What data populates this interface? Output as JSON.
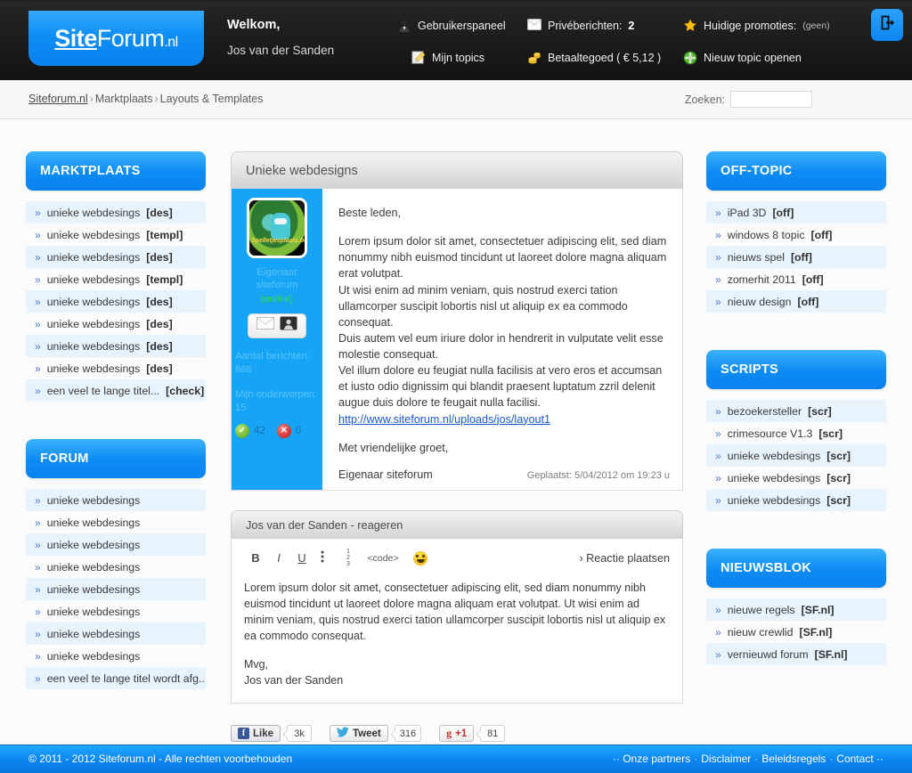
{
  "header": {
    "logo": {
      "bold": "Site",
      "rest": "Forum",
      "tld": ".nl"
    },
    "welcome_label": "Welkom,",
    "user_name": "Jos van der Sanden",
    "menu": [
      {
        "icon": "user-panel-icon",
        "label": "Gebruikerspaneel",
        "value": "",
        "dim": ""
      },
      {
        "icon": "envelope-icon",
        "label": "Privéberichten:",
        "value": "2",
        "dim": ""
      },
      {
        "icon": "star-icon",
        "label": "Huidige promoties:",
        "value": "",
        "dim": "(geen)"
      },
      {
        "icon": "pencil-note-icon",
        "label": "Mijn topics",
        "value": "",
        "dim": ""
      },
      {
        "icon": "coins-icon",
        "label": "Betaaltegoed ( € 5,12 )",
        "value": "",
        "dim": ""
      },
      {
        "icon": "plus-circle-icon",
        "label": "Nieuw topic openen",
        "value": "",
        "dim": ""
      }
    ],
    "logout_icon": "logout-icon"
  },
  "breadcrumb": {
    "root": "Siteforum.nl",
    "sep1": "›",
    "level1": "Marktplaats",
    "sep2": "›",
    "level2": "Layouts & Templates"
  },
  "search": {
    "label": "Zoeken:",
    "value": "",
    "placeholder": ""
  },
  "sidebar_left": [
    {
      "title": "MARKTPLAATS",
      "items": [
        {
          "label": "unieke webdesings",
          "tag": "[des]"
        },
        {
          "label": "unieke webdesings",
          "tag": "[templ]"
        },
        {
          "label": "unieke webdesings",
          "tag": "[des]"
        },
        {
          "label": "unieke webdesings",
          "tag": "[templ]"
        },
        {
          "label": "unieke webdesings",
          "tag": "[des]"
        },
        {
          "label": "unieke webdesings",
          "tag": "[des]"
        },
        {
          "label": "unieke webdesings",
          "tag": "[des]"
        },
        {
          "label": "unieke webdesings",
          "tag": "[des]"
        },
        {
          "label": "een veel te lange titel...",
          "tag": "[check]"
        }
      ]
    },
    {
      "title": "FORUM",
      "items": [
        {
          "label": "unieke webdesings",
          "tag": ""
        },
        {
          "label": "unieke webdesings",
          "tag": ""
        },
        {
          "label": "unieke webdesings",
          "tag": ""
        },
        {
          "label": "unieke webdesings",
          "tag": ""
        },
        {
          "label": "unieke webdesings",
          "tag": ""
        },
        {
          "label": "unieke webdesings",
          "tag": ""
        },
        {
          "label": "unieke webdesings",
          "tag": ""
        },
        {
          "label": "unieke webdesings",
          "tag": ""
        },
        {
          "label": "een veel te lange titel wordt afg...",
          "tag": ""
        }
      ]
    }
  ],
  "sidebar_right": [
    {
      "title": "OFF-TOPIC",
      "items": [
        {
          "label": "iPad 3D",
          "tag": "[off]"
        },
        {
          "label": "windows 8 topic",
          "tag": "[off]"
        },
        {
          "label": "nieuws spel",
          "tag": "[off]"
        },
        {
          "label": "zomerhit 2011",
          "tag": "[off]"
        },
        {
          "label": "nieuw design",
          "tag": "[off]"
        }
      ]
    },
    {
      "title": "SCRIPTS",
      "items": [
        {
          "label": "bezoekersteller",
          "tag": "[scr]"
        },
        {
          "label": "crimesource V1.3",
          "tag": "[scr]"
        },
        {
          "label": "unieke webdesings",
          "tag": "[scr]"
        },
        {
          "label": "unieke webdesings",
          "tag": "[scr]"
        },
        {
          "label": "unieke webdesings",
          "tag": "[scr]"
        }
      ]
    },
    {
      "title": "NIEUWSBLOK",
      "items": [
        {
          "label": "nieuwe regels",
          "tag": "[SF.nl]"
        },
        {
          "label": "nieuw crewlid",
          "tag": "[SF.nl]"
        },
        {
          "label": "vernieuwd forum",
          "tag": "[SF.nl]"
        }
      ]
    }
  ],
  "post": {
    "title": "Unieke webdesigns",
    "author": {
      "avatar_caption": "Spelletjesplaats.be",
      "name": "Eigenaar siteforum",
      "status": "(online)",
      "pm_icon": "envelope-icon",
      "profile_icon": "profile-card-icon",
      "posts_label": "Aantal berichten:",
      "posts_value": "866",
      "topics_label": "Mijn onderwerpen:",
      "topics_value": "15",
      "positive": "42",
      "negative": "0"
    },
    "greeting": "Beste leden,",
    "paragraphs": [
      "Lorem ipsum dolor sit amet, consectetuer adipiscing elit, sed diam nonummy nibh euismod tincidunt ut laoreet dolore magna aliquam erat volutpat.",
      "Ut wisi enim ad minim veniam, quis nostrud exerci tation ullamcorper suscipit lobortis nisl ut aliquip ex ea commodo consequat.",
      "Duis autem vel eum iriure dolor in hendrerit in vulputate velit esse molestie consequat.",
      "Vel illum dolore eu feugiat nulla facilisis at vero eros et accumsan et iusto odio dignissim qui blandit praesent luptatum zzril delenit augue duis dolore te feugait nulla facilisi."
    ],
    "link": "http://www.siteforum.nl/uploads/jos/layout1",
    "closing": "Met vriendelijke groet,",
    "signature": "Eigenaar siteforum",
    "timestamp": "Geplaatst: 5/04/2012 om 19:23 u"
  },
  "reply": {
    "header": "Jos van der Sanden - reageren",
    "toolbar": {
      "bold": "B",
      "italic": "I",
      "underline": "U",
      "bullet_list": "bullet-list-icon",
      "numbered_list_1": "1",
      "numbered_list_2": "2",
      "numbered_list_3": "3",
      "code": "<code>",
      "smiley": "smiley-icon"
    },
    "submit_label": "› Reactie plaatsen",
    "body_line1": "Lorem ipsum dolor sit amet, consectetuer adipiscing elit, sed diam nonummy nibh euismod tincidunt ut laoreet dolore magna aliquam erat volutpat. Ut wisi enim ad minim veniam, quis nostrud exerci tation ullamcorper suscipit lobortis nisl ut aliquip ex ea commodo consequat.",
    "body_line2": "Mvg,",
    "body_line3": "Jos van der Sanden"
  },
  "social": {
    "facebook": {
      "label": "Like",
      "count": "3k",
      "icon": "facebook-icon"
    },
    "twitter": {
      "label": "Tweet",
      "count": "316",
      "icon": "twitter-bird-icon"
    },
    "google": {
      "label": "+1",
      "count": "81",
      "icon": "google-plus-icon"
    }
  },
  "footer": {
    "copyright": "© 2011 - 2012  Siteforum.nl  - Alle rechten voorbehouden",
    "prefix": "··",
    "links": [
      "Onze partners",
      "Disclaimer",
      "Beleidsregels",
      "Contact"
    ],
    "suffix": "··"
  },
  "colors": {
    "brand_blue": "#0d8cf4",
    "header_dark": "#1b1b1b",
    "row_alt": "#e8f4fd",
    "online_green": "#35e035",
    "link_blue": "#1a57d0"
  }
}
